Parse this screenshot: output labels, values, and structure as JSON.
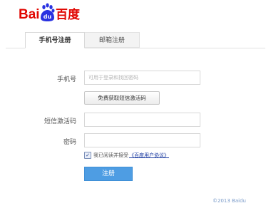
{
  "brand": {
    "logo_alt": "Baidu 百度",
    "colors": {
      "red": "#e10601",
      "blue": "#2932e1"
    }
  },
  "tabs": [
    {
      "label": "手机号注册",
      "active": true
    },
    {
      "label": "邮箱注册",
      "active": false
    }
  ],
  "form": {
    "phone_label": "手机号",
    "phone_placeholder": "可用于登录和找回密码",
    "sms_button": "免费获取短信激活码",
    "code_label": "短信激活码",
    "password_label": "密码",
    "agree_text": "我已阅读并接受",
    "agree_link": "《百度用户协议》",
    "agree_checked": true,
    "submit": "注册"
  },
  "footer": {
    "copyright": "©2013 Baidu"
  }
}
